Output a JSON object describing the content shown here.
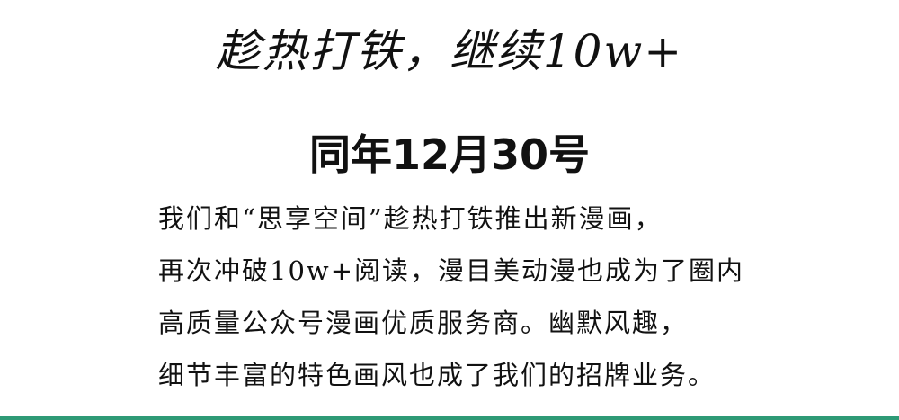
{
  "headline": "趁热打铁，继续10w+",
  "date_heading": "同年12月30号",
  "body": {
    "lines": [
      "我们和“思享空间”趁热打铁推出新漫画，",
      "再次冲破10w+阅读，漫目美动漫也成为了圈内",
      "高质量公众号漫画优质服务商。幽默风趣，",
      "细节丰富的特色画风也成了我们的招牌业务。"
    ]
  },
  "colors": {
    "text": "#111111",
    "background": "#ffffff",
    "bottom_rule": "#2e9a76"
  }
}
